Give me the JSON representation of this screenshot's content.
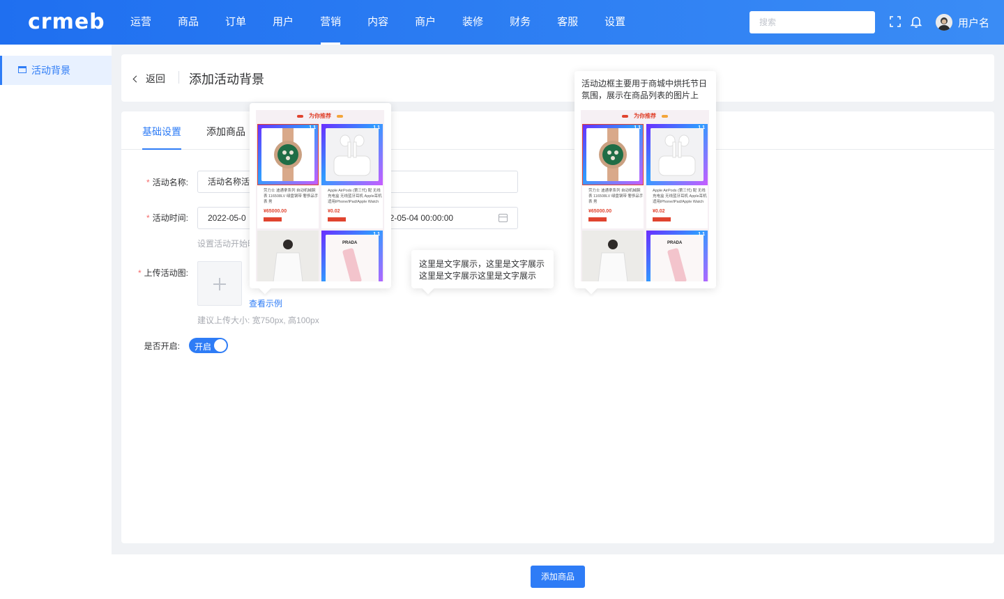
{
  "header": {
    "logo": "crmeb",
    "nav": [
      "运营",
      "商品",
      "订单",
      "用户",
      "营销",
      "内容",
      "商户",
      "装修",
      "财务",
      "客服",
      "设置"
    ],
    "active_nav": 4,
    "search_placeholder": "搜索",
    "username": "用户名"
  },
  "sidebar": {
    "items": [
      {
        "label": "活动背景",
        "icon": "frame-icon"
      }
    ]
  },
  "page": {
    "back_label": "返回",
    "title": "添加活动背景"
  },
  "tabs": [
    "基础设置",
    "添加商品"
  ],
  "form": {
    "name_label": "活动名称:",
    "name_value": "活动名称活",
    "time_label": "活动时间:",
    "time_start": "2022-05-0",
    "time_end": "22-05-04 00:00:00",
    "time_hint": "设置活动开始时",
    "upload_label": "上传活动图:",
    "view_example": "查看示例",
    "upload_hint": "建议上传大小: 宽750px, 高100px",
    "enable_label": "是否开启:",
    "switch_on_text": "开启"
  },
  "popover_text": {
    "middle": "这里是文字展示，这里是文字展示这里是文字展示这里是文字展示",
    "right": "活动边框主要用于商城中烘托节日氛围，展示在商品列表的图片上"
  },
  "preview": {
    "header": "为你推荐",
    "tag": "1.1",
    "products": [
      {
        "name": "劳力士 迪通拿系列 自动机械腕表 116508LV 绿盘钢带 奢侈品手表 男",
        "price": "¥65000.00"
      },
      {
        "name": "Apple AirPods (第三代) 配 无线充电盒 无线蓝牙耳机 Apple耳机 适用iPhone/iPad/Apple Watch",
        "price": "¥0.02"
      },
      {
        "name": "",
        "price": ""
      },
      {
        "name": "PRADA",
        "price": ""
      }
    ]
  },
  "bottom_button": "添加商品",
  "colors": {
    "primary": "#2e7cf6",
    "required": "#f56c6c",
    "price": "#e0442f"
  }
}
